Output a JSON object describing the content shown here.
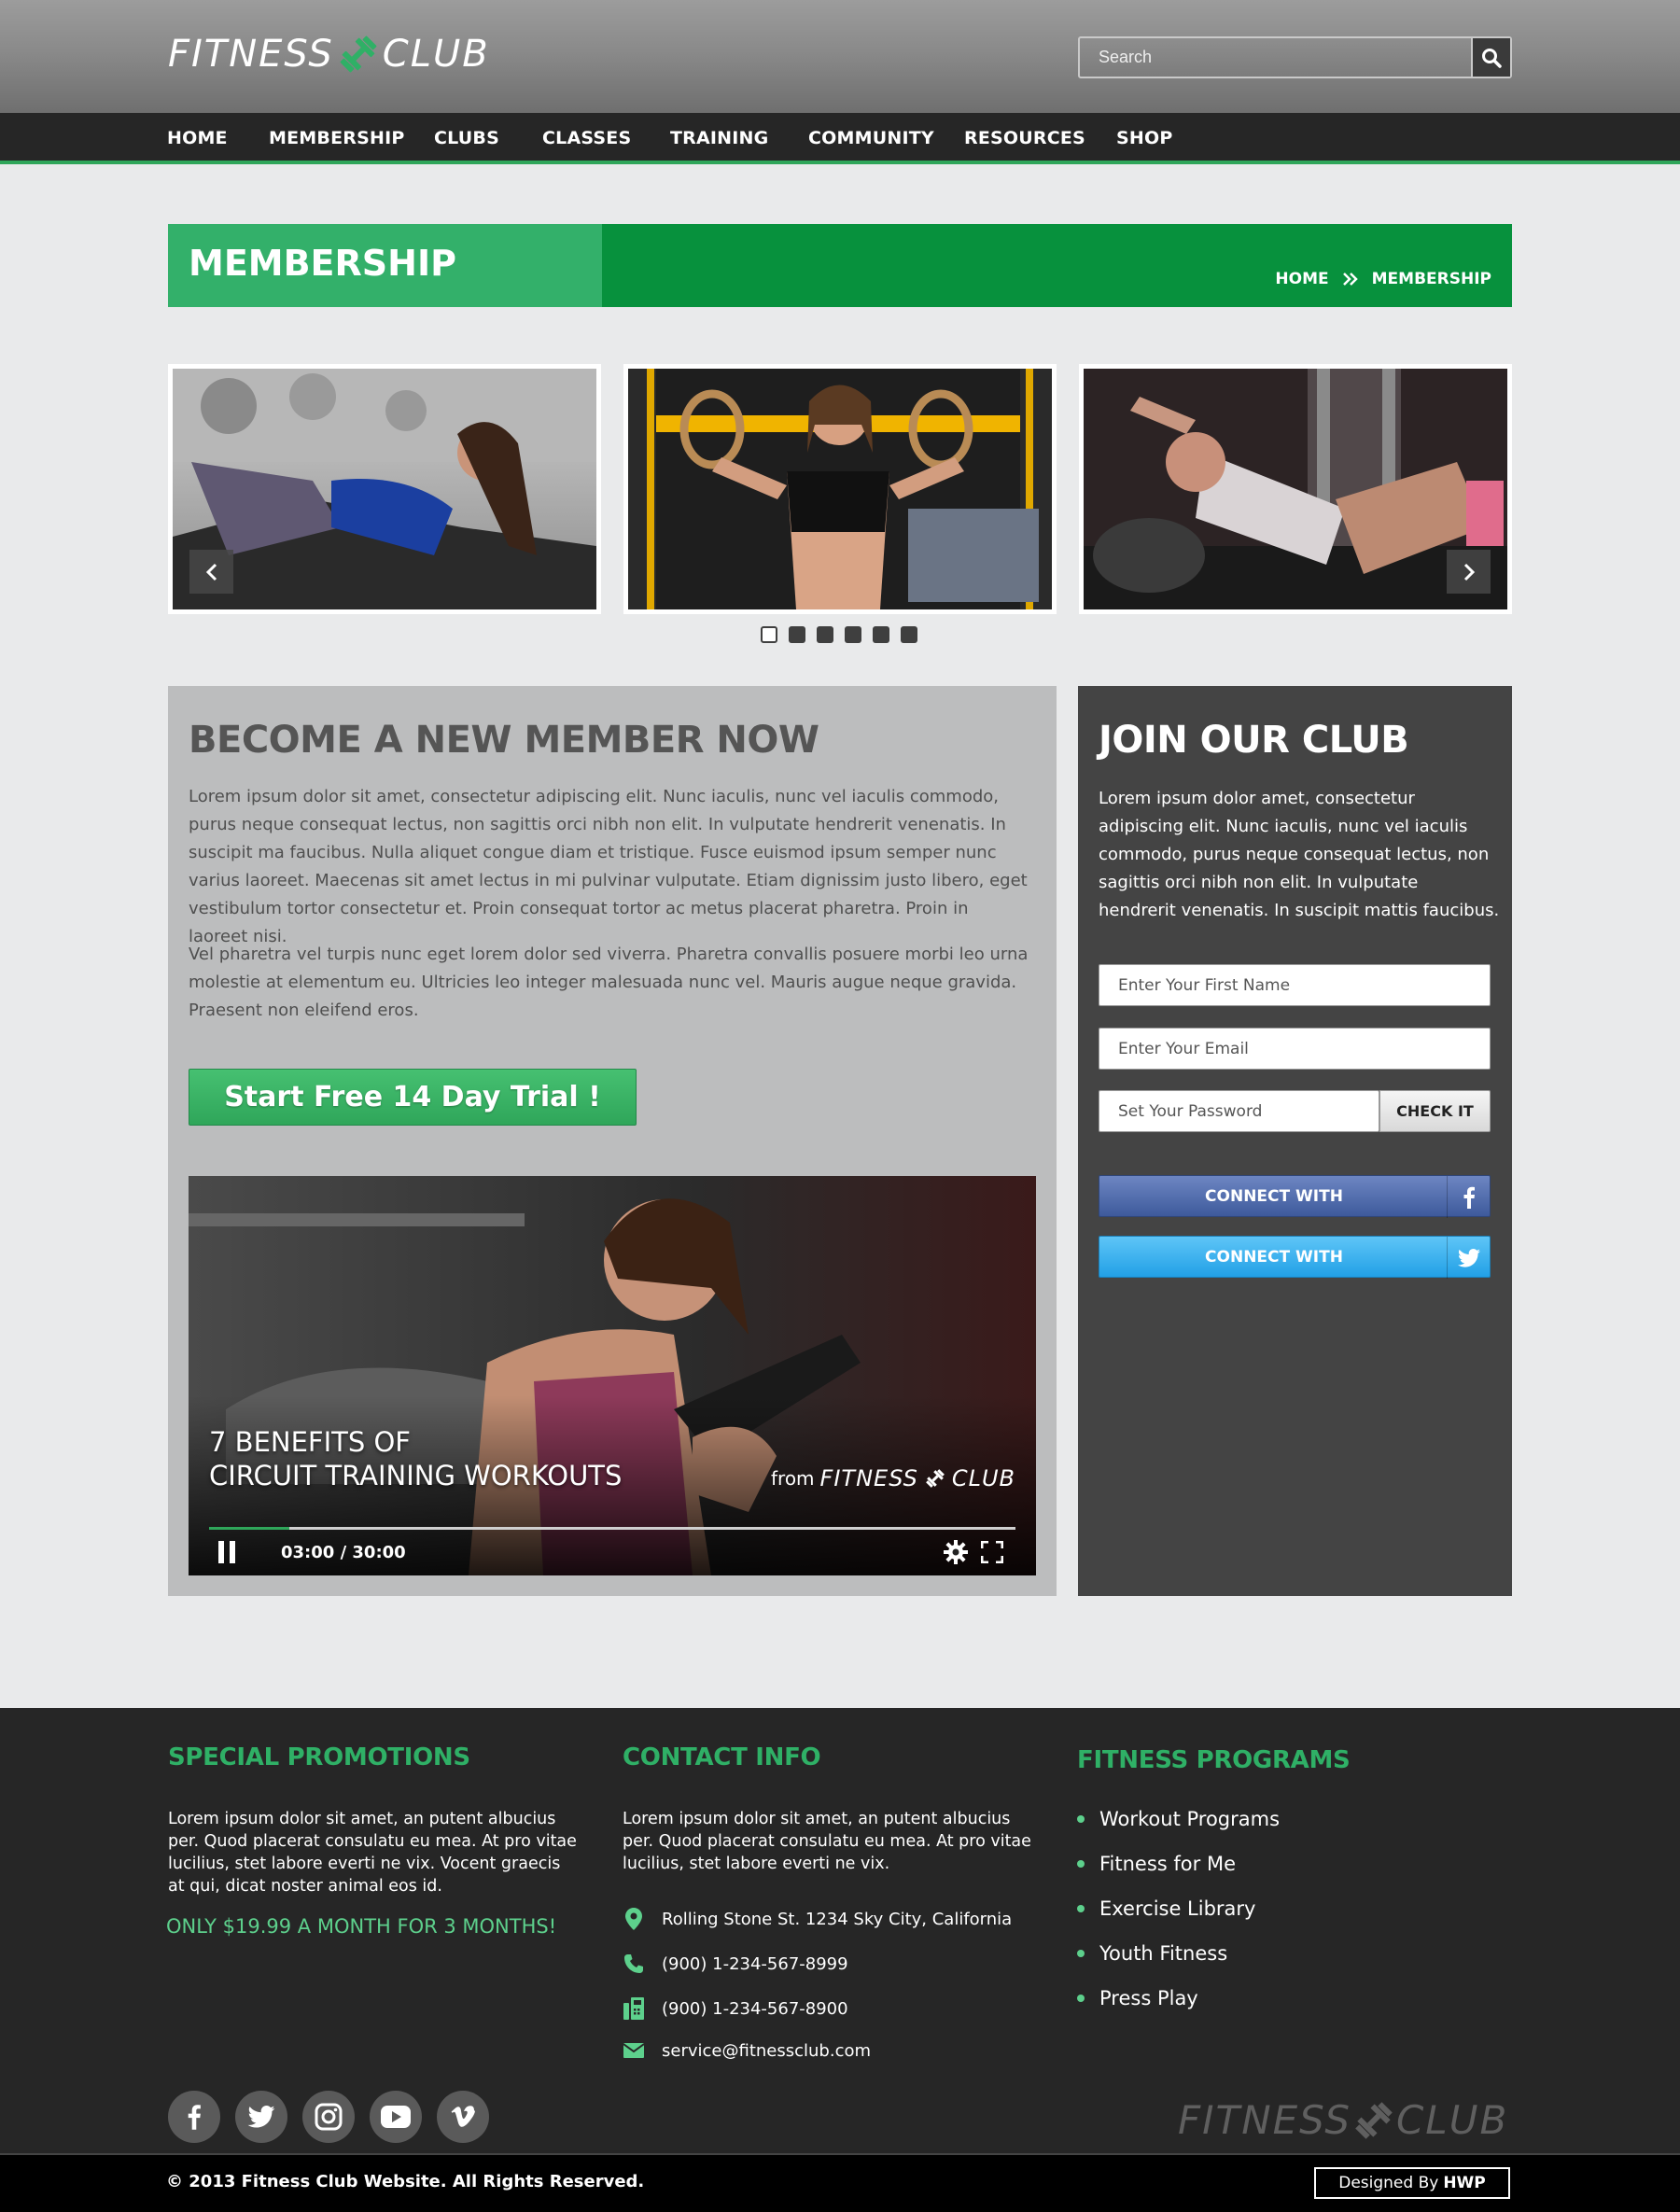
{
  "header": {
    "logo": {
      "left": "FITNESS",
      "right": "CLUB"
    },
    "search": {
      "placeholder": "Search"
    }
  },
  "nav": {
    "items": [
      "HOME",
      "MEMBERSHIP",
      "CLUBS",
      "CLASSES",
      "TRAINING",
      "COMMUNITY",
      "RESOURCES",
      "SHOP"
    ]
  },
  "page_title": {
    "title": "MEMBERSHIP",
    "breadcrumb": {
      "home": "HOME",
      "current": "MEMBERSHIP"
    }
  },
  "carousel": {
    "slide_count": 3,
    "dots": 6,
    "active_dot": 0
  },
  "member": {
    "heading": "BECOME A NEW MEMBER NOW",
    "paragraph1": "Lorem ipsum dolor sit amet, consectetur adipiscing elit. Nunc iaculis, nunc vel iaculis commodo, purus neque consequat lectus, non sagittis orci nibh non elit. In vulputate hendrerit venenatis. In suscipit ma faucibus. Nulla aliquet congue diam et tristique. Fusce euismod ipsum semper nunc varius laoreet. Maecenas sit amet lectus in mi pulvinar vulputate. Etiam dignissim justo libero, eget vestibulum tortor consectetur et. Proin consequat tortor ac metus placerat pharetra. Proin in laoreet nisi.",
    "paragraph2": "Vel pharetra vel turpis nunc eget lorem dolor sed viverra. Pharetra convallis posuere morbi leo urna molestie at elementum eu. Ultricies leo integer malesuada nunc vel. Mauris augue neque gravida. Praesent non eleifend eros.",
    "trial_button": "Start Free 14 Day Trial !"
  },
  "video": {
    "title_line1": "7 BENEFITS OF",
    "title_line2": "CIRCUIT TRAINING WORKOUTS",
    "from": "from",
    "time": "03:00 / 30:00",
    "progress": 0.1
  },
  "join": {
    "heading": "JOIN OUR CLUB",
    "paragraph": "Lorem ipsum dolor amet, consectetur adipiscing elit. Nunc iaculis, nunc vel iaculis commodo, purus neque consequat lectus, non sagittis orci nibh non elit. In vulputate hendrerit venenatis. In suscipit mattis faucibus.",
    "first_name_placeholder": "Enter Your First Name",
    "email_placeholder": "Enter Your Email",
    "password_placeholder": "Set Your Password",
    "check_button": "CHECK IT",
    "connect_facebook": "CONNECT WITH",
    "connect_twitter": "CONNECT WITH"
  },
  "footer": {
    "promotions": {
      "heading": "SPECIAL PROMOTIONS",
      "text": "Lorem ipsum dolor sit amet, an putent albucius per. Quod placerat consulatu eu mea. At pro vitae lucilius, stet labore everti ne vix. Vocent graecis at qui, dicat noster animal eos id.",
      "offer": "ONLY $19.99 A MONTH FOR 3 MONTHS!"
    },
    "contact": {
      "heading": "CONTACT INFO",
      "text": "Lorem ipsum dolor sit amet, an putent albucius per. Quod placerat consulatu eu mea. At pro vitae lucilius, stet labore everti ne vix.",
      "address": "Rolling Stone St. 1234 Sky City, California",
      "phone": "(900) 1-234-567-8999",
      "fax": "(900) 1-234-567-8900",
      "email": "service@fitnessclub.com"
    },
    "programs": {
      "heading": "FITNESS PROGRAMS",
      "items": [
        "Workout Programs",
        "Fitness for Me",
        "Exercise Library",
        "Youth Fitness",
        "Press Play"
      ]
    },
    "copyright": "© 2013 Fitness Club Website. All Rights Reserved.",
    "designed_by_label": "Designed By",
    "designed_by_name": "HWP"
  },
  "colors": {
    "accent_green": "#2fa65a",
    "dark_bar": "#262626",
    "facebook": "#3e5a9c",
    "twitter": "#22a0e6"
  }
}
